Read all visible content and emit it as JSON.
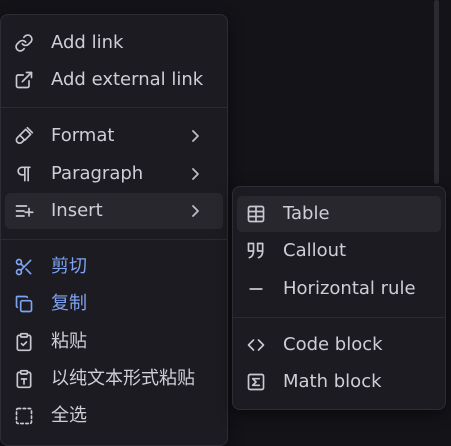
{
  "main_menu": {
    "items": [
      {
        "label": "Add link",
        "icon": "link-icon"
      },
      {
        "label": "Add external link",
        "icon": "external-link-icon"
      },
      {
        "label": "Format",
        "icon": "paintbrush-icon",
        "submenu": true
      },
      {
        "label": "Paragraph",
        "icon": "pilcrow-icon",
        "submenu": true
      },
      {
        "label": "Insert",
        "icon": "list-plus-icon",
        "submenu": true,
        "active": true
      },
      {
        "label": "剪切",
        "icon": "scissors-icon"
      },
      {
        "label": "复制",
        "icon": "copy-icon"
      },
      {
        "label": "粘贴",
        "icon": "clipboard-check-icon"
      },
      {
        "label": "以纯文本形式粘贴",
        "icon": "clipboard-text-icon"
      },
      {
        "label": "全选",
        "icon": "select-all-icon"
      }
    ]
  },
  "insert_submenu": {
    "items": [
      {
        "label": "Table",
        "icon": "table-icon",
        "active": true
      },
      {
        "label": "Callout",
        "icon": "quote-icon"
      },
      {
        "label": "Horizontal rule",
        "icon": "minus-icon"
      },
      {
        "label": "Code block",
        "icon": "code-icon"
      },
      {
        "label": "Math block",
        "icon": "sigma-icon"
      }
    ]
  },
  "colors": {
    "background": "#141318",
    "menu_background": "#1c1b21",
    "text": "#cfced6",
    "accent_blue": "#7fa3f3",
    "active_row": "#28272e"
  }
}
